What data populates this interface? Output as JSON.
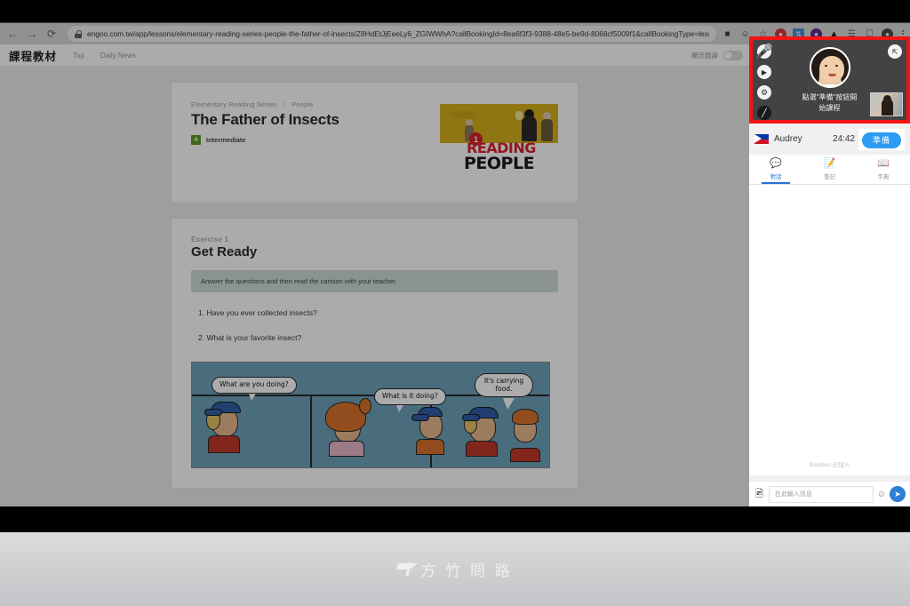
{
  "browser": {
    "back_icon": "back-arrow",
    "forward_icon": "forward-arrow",
    "reload_icon": "reload",
    "url": "engoo.com.tw/app/lessons/elementary-reading-series-people-the-father-of-insects/Z8HdEtJjEeeLy6_ZGIWWhA?callBookingId=8ea6f3f3-9388-48e5-be9d-8068cf5009f1&callBookingType=lesson&category_id=w…",
    "extensions": [
      "media-icon",
      "cast-icon",
      "bookmark-star-icon",
      "adblock-icon",
      "sync-icon",
      "profile-badge-icon",
      "home-icon",
      "list-icon",
      "window-icon",
      "avatar-icon"
    ],
    "menu_icon": "kebab-menu-icon"
  },
  "app_header": {
    "brand": "課程教材",
    "links": [
      "Top",
      "Daily News"
    ],
    "translate_label": "顯示翻譯",
    "translate_on": false
  },
  "lesson": {
    "breadcrumb": [
      "Elementary Reading Series",
      "People"
    ],
    "breadcrumb_sep": "/",
    "title": "The Father of Insects",
    "level_number": "4",
    "level_name": "Intermediate",
    "thumb": {
      "reading": "READING",
      "people": "PEOPLE",
      "badge": "1"
    }
  },
  "exercise": {
    "label": "Exercise 1",
    "title": "Get Ready",
    "instruction": "Answer the questions and then read the cartoon with your teacher.",
    "questions": [
      "1. Have you ever collected insects?",
      "2. What is your favorite insect?"
    ],
    "cartoon_bubbles": [
      "What are you doing?",
      "What is it doing?",
      "It's carrying food."
    ]
  },
  "call": {
    "message_line1": "點選\"準備\"按鈕開",
    "message_line2": "始課程",
    "controls": [
      "microphone-icon",
      "camera-icon",
      "gear-icon",
      "video-off-icon"
    ],
    "expand_icon": "expand-icon",
    "teacher_name": "Audrey",
    "flag": "philippines-flag",
    "timer": "24:42",
    "ready_label": "準備",
    "accent_color": "#2d9cf0",
    "border_color": "#f51212"
  },
  "panel_tabs": [
    {
      "label": "對話",
      "icon": "chat-icon",
      "active": true
    },
    {
      "label": "筆記",
      "icon": "notes-icon",
      "active": false
    },
    {
      "label": "字典",
      "icon": "dictionary-icon",
      "active": false
    }
  ],
  "chat": {
    "system_message": "Bamboo 已加入",
    "placeholder": "在此輸入訊息",
    "attach_icon": "attach-image-icon",
    "emoji_icon": "emoji-icon",
    "send_icon": "send-icon"
  },
  "footer": {
    "watermark": "方 竹 問 路"
  }
}
